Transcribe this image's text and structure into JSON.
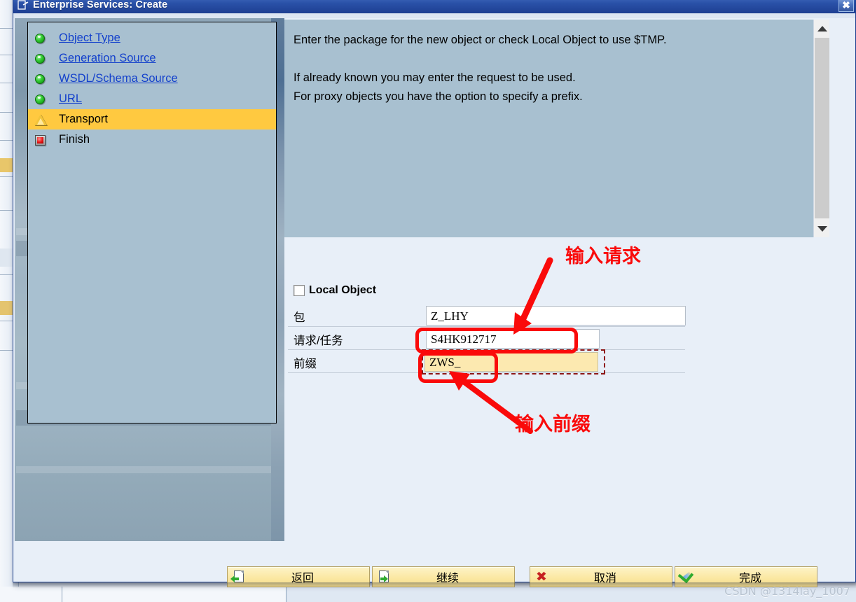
{
  "window": {
    "title": "Enterprise Services: Create",
    "title_icon": "create-document-icon",
    "close_label": "✖"
  },
  "tree": {
    "items": [
      {
        "label": "Object Type",
        "icon": "green-status-icon",
        "state": "link",
        "name": "object-type"
      },
      {
        "label": "Generation Source",
        "icon": "green-status-icon",
        "state": "link",
        "name": "generation-source"
      },
      {
        "label": "WSDL/Schema Source",
        "icon": "green-status-icon",
        "state": "link",
        "name": "wsdl-schema-source"
      },
      {
        "label": "URL",
        "icon": "green-status-icon",
        "state": "link",
        "name": "url"
      },
      {
        "label": "Transport",
        "icon": "warning-triangle-icon",
        "state": "selected",
        "name": "transport"
      },
      {
        "label": "Finish",
        "icon": "red-stop-icon",
        "state": "plain",
        "name": "finish"
      }
    ]
  },
  "instructions": {
    "line1": "Enter the package for the new object or check Local Object to use $TMP.",
    "line2": "",
    "line3": "If already known you may enter the request to be used.",
    "line4": "For proxy objects you have the option to specify a prefix.",
    "text": "Enter the package for the new object or check Local Object to use $TMP.\n\nIf already known you may enter the request to be used.\nFor proxy objects you have the option to specify a prefix."
  },
  "scrollbar": {
    "up_icon": "chevron-up-icon",
    "down_icon": "chevron-down-icon"
  },
  "form": {
    "local_object": {
      "label": "Local Object",
      "checked": false
    },
    "fields": [
      {
        "label": "包",
        "value": "Z_LHY",
        "name": "package"
      },
      {
        "label": "请求/任务",
        "value": "S4HK912717",
        "name": "request-task"
      },
      {
        "label": "前缀",
        "value": "ZWS_",
        "name": "prefix"
      }
    ]
  },
  "annotations": [
    {
      "text": "输入请求",
      "name": "annotation-enter-request"
    },
    {
      "text": "输入前缀",
      "name": "annotation-enter-prefix"
    }
  ],
  "buttons": [
    {
      "label": "返回",
      "icon": "back-icon",
      "name": "back-button"
    },
    {
      "label": "继续",
      "icon": "continue-icon",
      "name": "continue-button"
    },
    {
      "label": "取消",
      "icon": "cancel-icon",
      "name": "cancel-button"
    },
    {
      "label": "完成",
      "icon": "complete-icon",
      "name": "complete-button"
    }
  ],
  "watermark": {
    "text": "CSDN @1314lay_1007"
  },
  "colors": {
    "accent": "#1e3f92",
    "selected_row": "#ffc940",
    "annotation": "#fa0a0a",
    "panel": "#a8c0d0",
    "dialog_bg": "#e8eff8",
    "field_yellow": "#fce9b0",
    "button": "#fbe9a6"
  }
}
